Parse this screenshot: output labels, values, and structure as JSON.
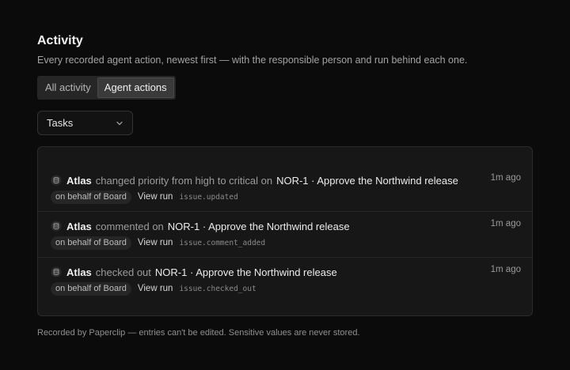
{
  "header": {
    "title": "Activity",
    "subtitle": "Every recorded agent action, newest first — with the responsible person and run behind each one."
  },
  "tabs": [
    {
      "label": "All activity",
      "active": false
    },
    {
      "label": "Agent actions",
      "active": true
    }
  ],
  "filter": {
    "selected": "Tasks"
  },
  "entries": [
    {
      "actor": "Atlas",
      "verb": "changed priority from high to critical on",
      "target": "NOR-1 · Approve the Northwind release",
      "time": "1m ago",
      "badge": "on behalf of Board",
      "view_run": "View run",
      "event": "issue.updated"
    },
    {
      "actor": "Atlas",
      "verb": "commented on",
      "target": "NOR-1 · Approve the Northwind release",
      "time": "1m ago",
      "badge": "on behalf of Board",
      "view_run": "View run",
      "event": "issue.comment_added"
    },
    {
      "actor": "Atlas",
      "verb": "checked out",
      "target": "NOR-1 · Approve the Northwind release",
      "time": "1m ago",
      "badge": "on behalf of Board",
      "view_run": "View run",
      "event": "issue.checked_out"
    }
  ],
  "footer": {
    "text": "Recorded by Paperclip — entries can't be edited. Sensitive values are never stored."
  },
  "icons": {
    "agent": "database-icon",
    "dropdown": "chevron-down-icon"
  }
}
